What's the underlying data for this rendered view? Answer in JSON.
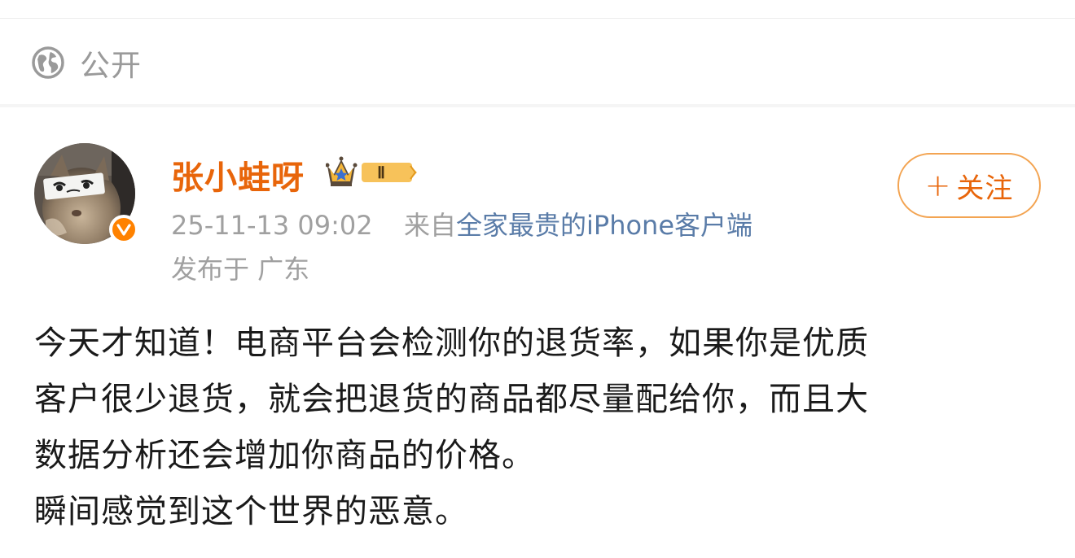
{
  "visibility": {
    "icon": "globe-icon",
    "label": "公开"
  },
  "author": {
    "name": "张小蛙呀",
    "avatar_icon": "cat-avatar",
    "verified_icon": "verified-v-icon",
    "vip_badge_icon": "crown-icon",
    "vip_level": "Ⅱ"
  },
  "meta": {
    "timestamp": "25-11-13 09:02",
    "from_prefix": "来自",
    "source": "全家最贵的iPhone客户端",
    "location": "发布于 广东"
  },
  "follow_button": {
    "plus": "+",
    "label": "关注"
  },
  "post": {
    "lines": [
      "今天才知道！电商平台会检测你的退货率，如果你是优质",
      "客户很少退货，就会把退货的商品都尽量配给你，而且大",
      "数据分析还会增加你商品的价格。",
      "瞬间感觉到这个世界的恶意。"
    ]
  },
  "colors": {
    "accent_orange": "#e8650a",
    "meta_gray": "#a0a0a0",
    "link_blue": "#5a7ca8",
    "verified_orange": "#ff8200"
  }
}
